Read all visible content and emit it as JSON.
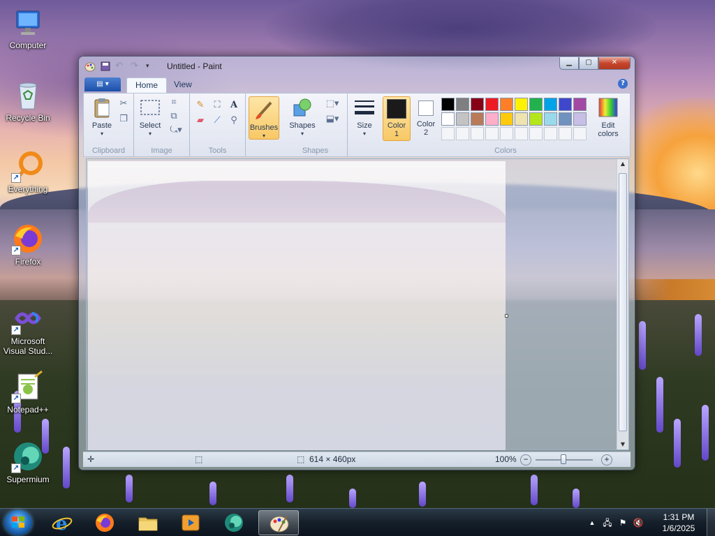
{
  "desktop": {
    "icons": [
      {
        "label": "Computer"
      },
      {
        "label": "Recycle Bin"
      },
      {
        "label": "Everything"
      },
      {
        "label": "Firefox"
      },
      {
        "label": "Microsoft Visual Stud..."
      },
      {
        "label": "Notepad++"
      },
      {
        "label": "Supermium"
      }
    ]
  },
  "paint": {
    "title": "Untitled - Paint",
    "tabs": {
      "home": "Home",
      "view": "View"
    },
    "clipboard": {
      "paste": "Paste",
      "group": "Clipboard"
    },
    "image": {
      "select": "Select",
      "group": "Image"
    },
    "tools": {
      "group": "Tools",
      "text_glyph": "A"
    },
    "brushes": {
      "label": "Brushes"
    },
    "shapes": {
      "label": "Shapes",
      "group": "Shapes"
    },
    "size": {
      "label": "Size"
    },
    "color1": {
      "label": "Color",
      "num": "1",
      "value": "#1a1a1a"
    },
    "color2": {
      "label": "Color",
      "num": "2",
      "value": "#ffffff"
    },
    "colors_group": "Colors",
    "edit_colors": {
      "line1": "Edit",
      "line2": "colors"
    },
    "palette_row1": [
      "#000000",
      "#7f7f7f",
      "#880015",
      "#ed1c24",
      "#ff7f27",
      "#fff200",
      "#22b14c",
      "#00a2e8",
      "#3f48cc",
      "#a349a4"
    ],
    "palette_row2": [
      "#ffffff",
      "#c3c3c3",
      "#b97a57",
      "#ffaec9",
      "#ffc90e",
      "#efe4b0",
      "#b5e61d",
      "#99d9ea",
      "#7092be",
      "#c8bfe7"
    ],
    "status": {
      "dimensions": "614 × 460px",
      "zoom": "100%"
    }
  },
  "taskbar": {
    "time": "1:31 PM",
    "date": "1/6/2025",
    "apps": [
      "internet-explorer",
      "firefox",
      "file-explorer",
      "media-player",
      "supermium",
      "paint"
    ]
  }
}
